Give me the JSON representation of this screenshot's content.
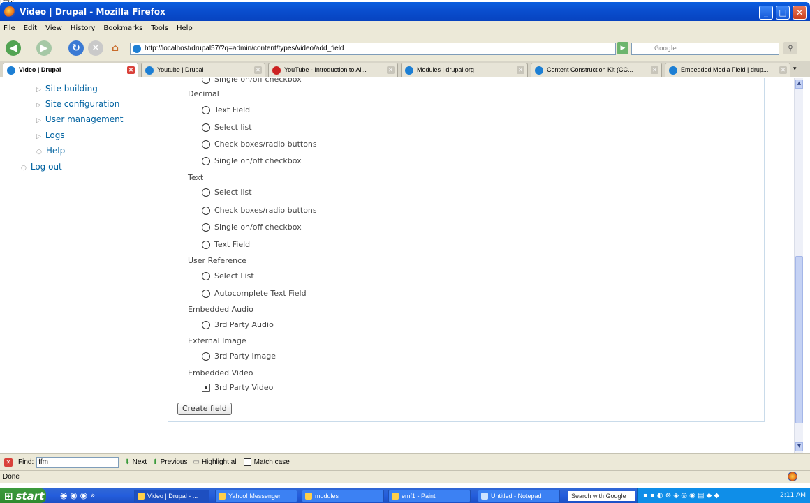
{
  "window": {
    "top_text": "page",
    "title": "Video | Drupal - Mozilla Firefox"
  },
  "menu": [
    "File",
    "Edit",
    "View",
    "History",
    "Bookmarks",
    "Tools",
    "Help"
  ],
  "nav": {
    "url": "http://localhost/drupal57/?q=admin/content/types/video/add_field",
    "search_placeholder": "Google"
  },
  "tabs": [
    {
      "label": "Video | Drupal",
      "active": true
    },
    {
      "label": "Youtube | Drupal"
    },
    {
      "label": "YouTube - Introduction to Al..."
    },
    {
      "label": "Modules | drupal.org"
    },
    {
      "label": "Content Construction Kit (CC..."
    },
    {
      "label": "Embedded Media Field | drup..."
    }
  ],
  "sidebar": [
    {
      "label": "Site building",
      "marker": "▷"
    },
    {
      "label": "Site configuration",
      "marker": "▷"
    },
    {
      "label": "User management",
      "marker": "▷"
    },
    {
      "label": "Logs",
      "marker": "▷"
    },
    {
      "label": "Help",
      "marker": "○"
    },
    {
      "label": "Log out",
      "marker": "○"
    }
  ],
  "content": {
    "partial_top": "Single on/off checkbox",
    "groups": [
      {
        "name": "Decimal",
        "options": [
          "Text Field",
          "Select list",
          "Check boxes/radio buttons",
          "Single on/off checkbox"
        ]
      },
      {
        "name": "Text",
        "options": [
          "Select list",
          "Check boxes/radio buttons",
          "Single on/off checkbox",
          "Text Field"
        ]
      },
      {
        "name": "User Reference",
        "options": [
          "Select List",
          "Autocomplete Text Field"
        ]
      },
      {
        "name": "Embedded Audio",
        "options": [
          "3rd Party Audio"
        ]
      },
      {
        "name": "External Image",
        "options": [
          "3rd Party Image"
        ]
      },
      {
        "name": "Embedded Video",
        "options": [
          "3rd Party Video"
        ]
      }
    ],
    "selected_option": "3rd Party Video",
    "create_button": "Create field"
  },
  "findbar": {
    "label": "Find:",
    "value": "ffm",
    "next": "Next",
    "previous": "Previous",
    "highlight": "Highlight all",
    "match_case": "Match case"
  },
  "status": "Done",
  "taskbar": {
    "start": "start",
    "tasks": [
      "Video | Drupal - ...",
      "Yahoo! Messenger",
      "modules",
      "emf1 - Paint",
      "Untitled - Notepad"
    ],
    "search": "Search with Google",
    "clock": "2:11 AM"
  }
}
